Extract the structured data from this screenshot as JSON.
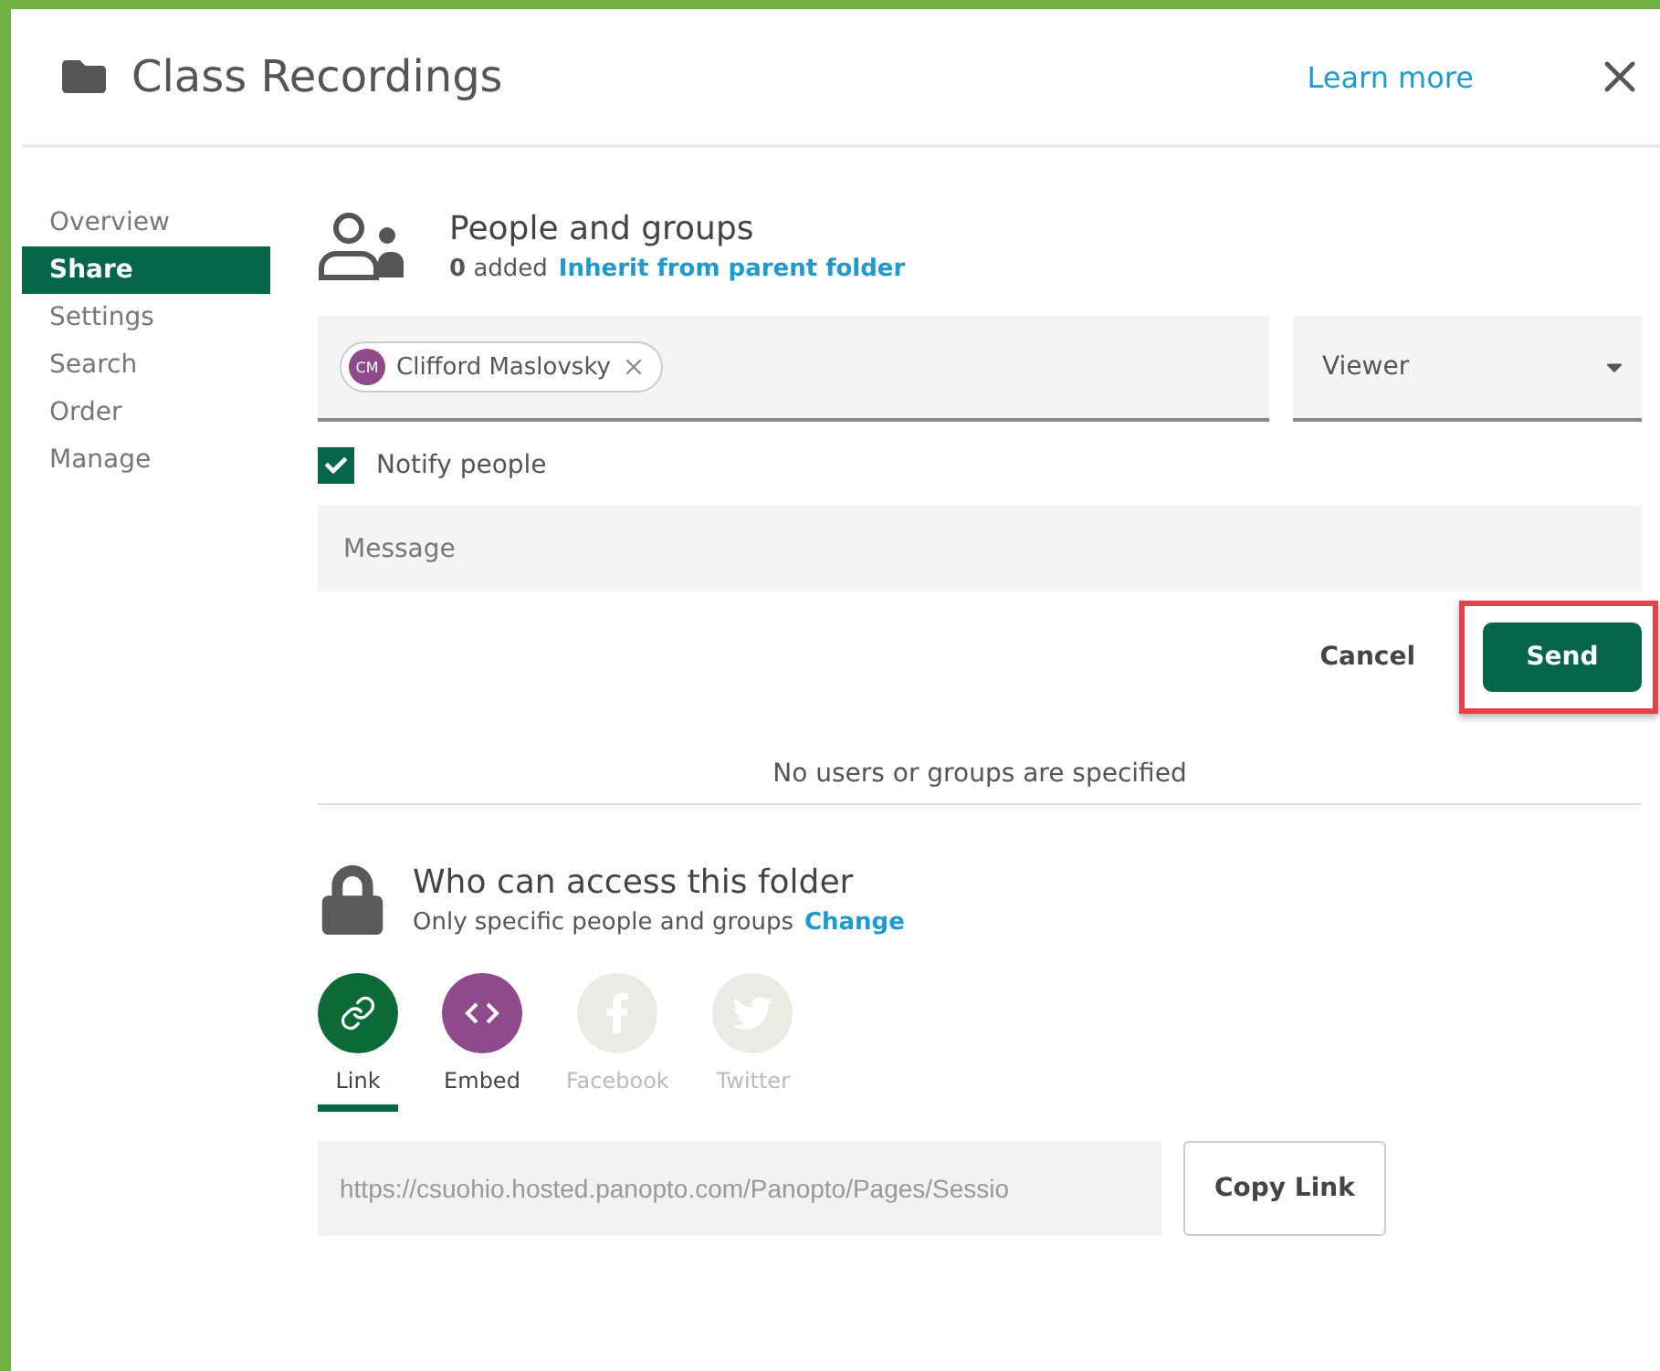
{
  "window": {
    "title": "Class Recordings",
    "learn_more": "Learn more"
  },
  "sidebar": {
    "items": [
      {
        "label": "Overview",
        "selected": false
      },
      {
        "label": "Share",
        "selected": true
      },
      {
        "label": "Settings",
        "selected": false
      },
      {
        "label": "Search",
        "selected": false
      },
      {
        "label": "Order",
        "selected": false
      },
      {
        "label": "Manage",
        "selected": false
      }
    ]
  },
  "people": {
    "title": "People and groups",
    "count": "0",
    "count_label": "added",
    "inherit_link": "Inherit from parent folder",
    "chips": [
      {
        "initials": "CM",
        "name": "Clifford Maslovsky",
        "color": "#8e4a8a"
      }
    ],
    "role": "Viewer",
    "notify": {
      "label": "Notify people",
      "checked": true
    },
    "message": {
      "placeholder": "Message"
    },
    "buttons": {
      "cancel": "Cancel",
      "send": "Send"
    },
    "empty": "No users or groups are specified"
  },
  "access": {
    "title": "Who can access this folder",
    "subtitle": "Only specific people and groups",
    "change_link": "Change",
    "share_options": [
      {
        "kind": "link",
        "label": "Link",
        "selected": true,
        "disabled": false
      },
      {
        "kind": "embed",
        "label": "Embed",
        "selected": false,
        "disabled": false
      },
      {
        "kind": "facebook",
        "label": "Facebook",
        "selected": false,
        "disabled": true
      },
      {
        "kind": "twitter",
        "label": "Twitter",
        "selected": false,
        "disabled": true
      }
    ],
    "url": "https://csuohio.hosted.panopto.com/Panopto/Pages/Sessio",
    "copy_button": "Copy Link"
  }
}
